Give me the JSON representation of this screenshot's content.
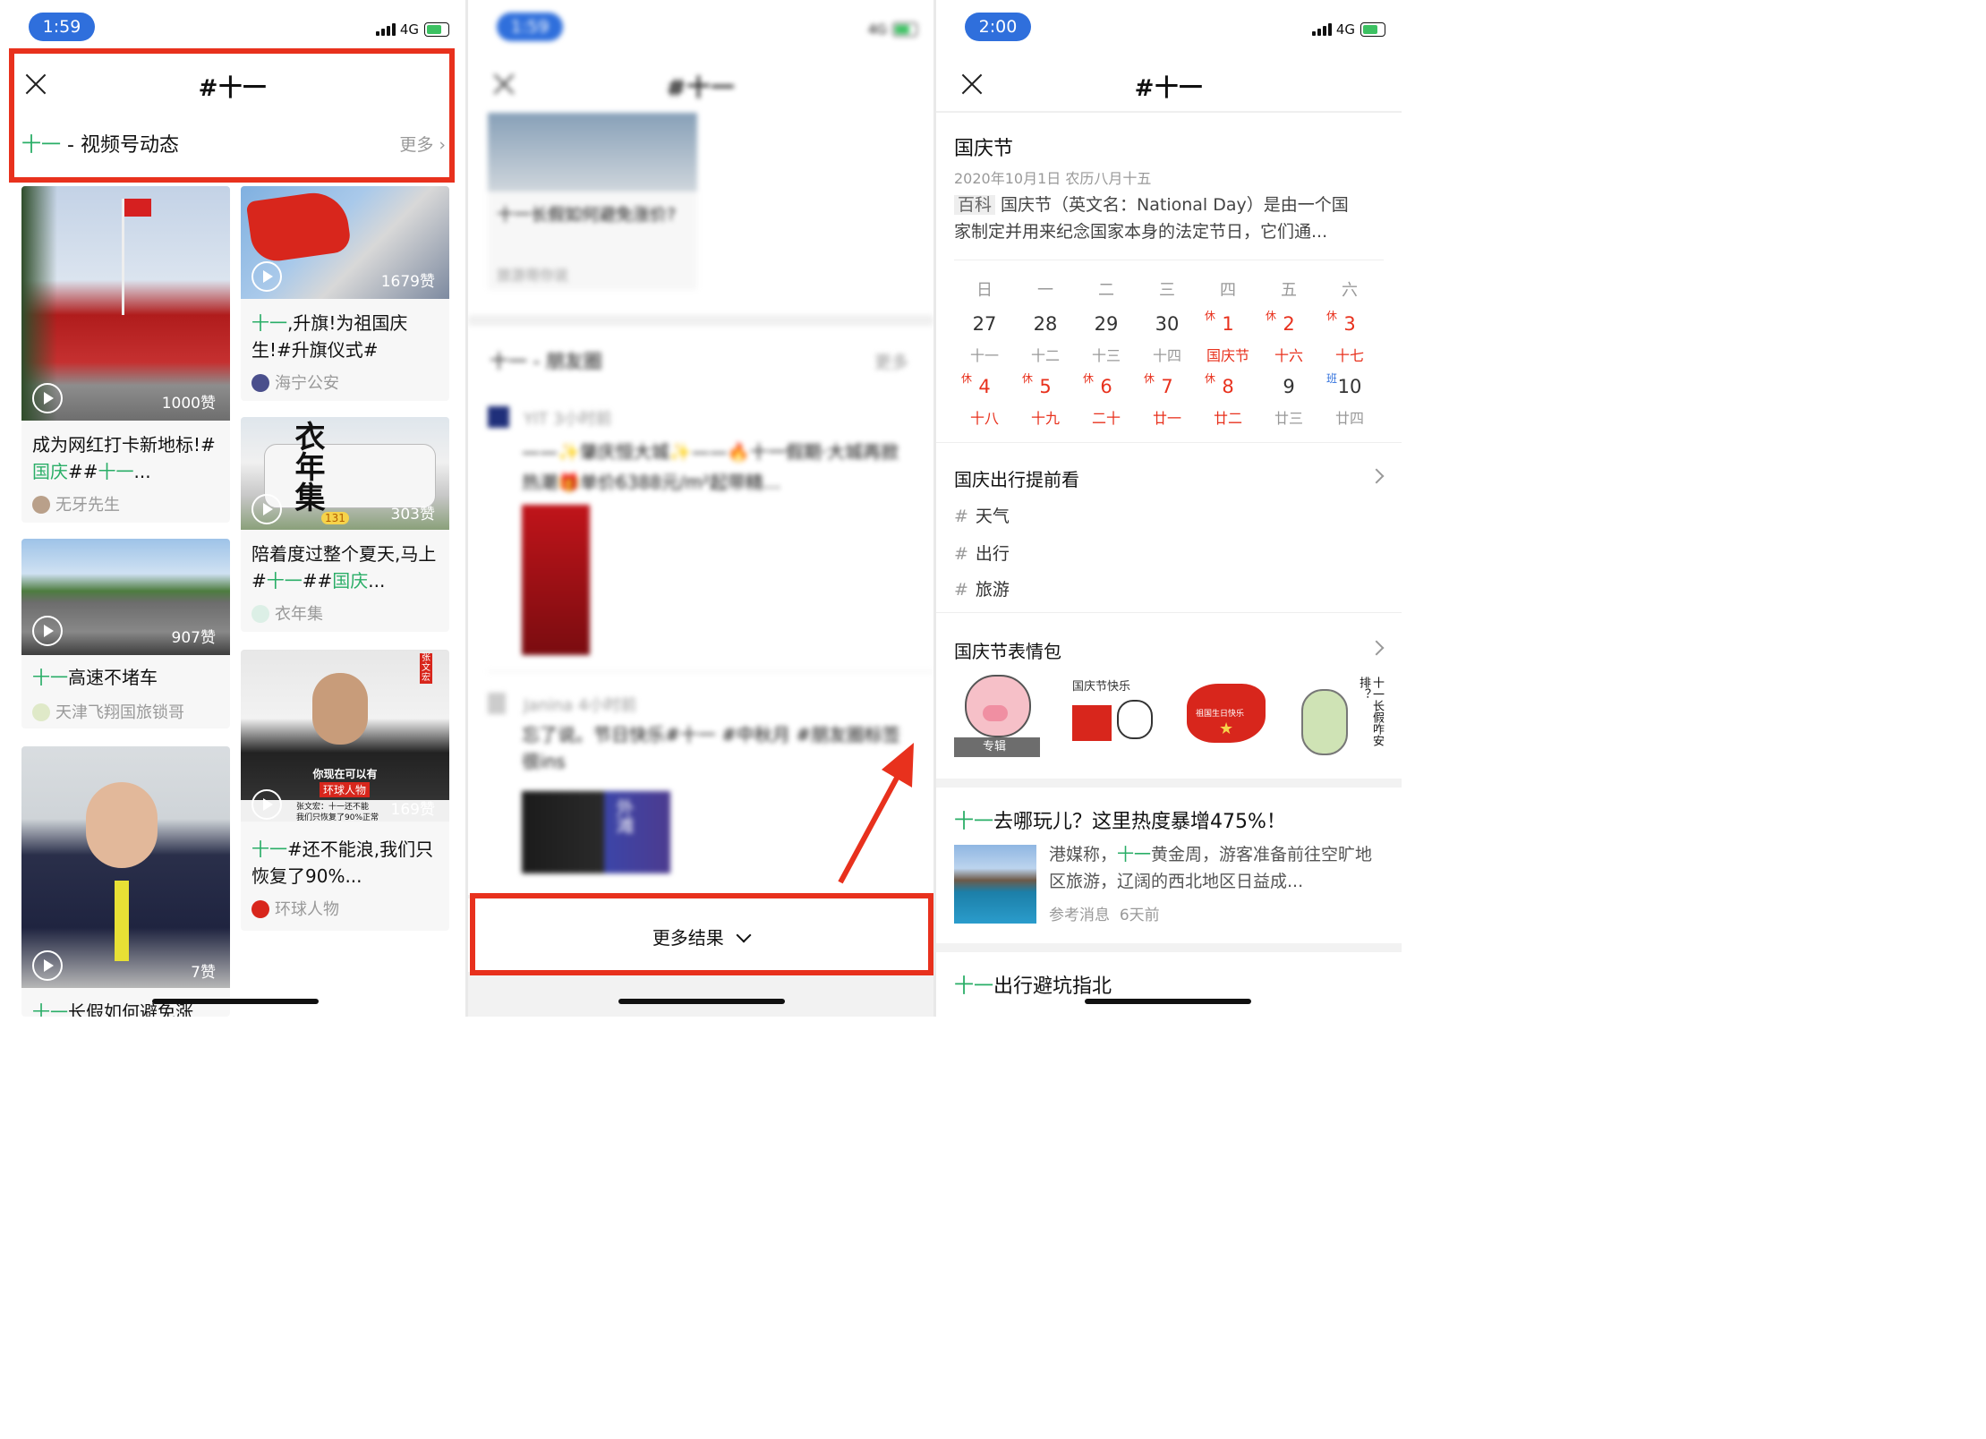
{
  "panel1": {
    "status": {
      "time": "1:59",
      "network": "4G"
    },
    "title": "#十一",
    "section": {
      "keyword": "十一",
      "label": " - 视频号动态",
      "more": "更多"
    },
    "cards": [
      {
        "likes": "1000赞",
        "title_a": "成为网红打卡新地标!#",
        "title_b_green": "国庆",
        "title_c": "##",
        "title_d_green": "十一",
        "title_e": "...",
        "author": "无牙先生"
      },
      {
        "likes": "907赞",
        "title_green": "十一",
        "title_rest": "高速不堵车",
        "author": "天津飞翔国旅锁哥"
      },
      {
        "likes": "7赞",
        "title_green": "十一",
        "title_rest": "长假如何避免涨"
      },
      {
        "likes": "1679赞",
        "title_green": "十一",
        "title_rest": ",升旗!为祖国庆生!#升旗仪式#",
        "author": "海宁公安"
      },
      {
        "likes": "303赞",
        "title_a": "陪着度过整个夏天,马上#",
        "title_b_green": "十一",
        "title_c": "##",
        "title_d_green": "国庆",
        "title_e": "...",
        "author": "衣年集",
        "poster_text": "衣年集",
        "poster_num": "131"
      },
      {
        "likes": "169赞",
        "title_green": "十一",
        "title_rest": "#还不能浪,我们只恢复了90%...",
        "author": "环球人物",
        "poster_line1": "你现在可以有",
        "poster_line2": "环球人物",
        "poster_line3": "张文宏：十一还不能",
        "poster_line4": "我们只恢复了90%正常",
        "poster_side": "张文宏"
      }
    ]
  },
  "panel2": {
    "status": {
      "time": "1:59",
      "network": "4G"
    },
    "title": "#十一",
    "snip_title": "十一长假如何避免涨价?",
    "snip_author": "旅游哥你说",
    "section_label": "十一 - 朋友圈",
    "section_more": "更多",
    "post1_author": "YIT 3小时前",
    "post1_text": "——✨肇庆恒大城✨——🔥十一假期·大城再掀热潮🎁单价6388元/m²起带精...",
    "post2_author": "Janina 4小时前",
    "post2_text": "忘了说。节日快乐#十一 #中秋月 #朋友圈标签很ins",
    "poster_text": "外滩",
    "more_results": "更多结果"
  },
  "panel3": {
    "status": {
      "time": "2:00",
      "network": "4G"
    },
    "title": "#十一",
    "holiday_title": "国庆节",
    "holiday_date": "2020年10月1日 农历八月十五",
    "baike_tag": "百科",
    "baike_text_1": "国庆节（英文名：National Day）是由一个国",
    "baike_text_2": "家制定并用来纪念国家本身的法定节日，它们通...",
    "calendar": {
      "headers": [
        "日",
        "一",
        "二",
        "三",
        "四",
        "五",
        "六"
      ],
      "row1": [
        {
          "d": "27",
          "l": "十一",
          "mark": "",
          "red": false
        },
        {
          "d": "28",
          "l": "十二",
          "mark": "",
          "red": false
        },
        {
          "d": "29",
          "l": "十三",
          "mark": "",
          "red": false
        },
        {
          "d": "30",
          "l": "十四",
          "mark": "",
          "red": false
        },
        {
          "d": "1",
          "l": "国庆节",
          "mark": "休",
          "red": true
        },
        {
          "d": "2",
          "l": "十六",
          "mark": "休",
          "red": true
        },
        {
          "d": "3",
          "l": "十七",
          "mark": "休",
          "red": true
        }
      ],
      "row2": [
        {
          "d": "4",
          "l": "十八",
          "mark": "休",
          "red": true
        },
        {
          "d": "5",
          "l": "十九",
          "mark": "休",
          "red": true
        },
        {
          "d": "6",
          "l": "二十",
          "mark": "休",
          "red": true
        },
        {
          "d": "7",
          "l": "廿一",
          "mark": "休",
          "red": true
        },
        {
          "d": "8",
          "l": "廿二",
          "mark": "休",
          "red": true
        },
        {
          "d": "9",
          "l": "廿三",
          "mark": "",
          "red": false
        },
        {
          "d": "10",
          "l": "廿四",
          "mark": "班",
          "red": false
        }
      ]
    },
    "travel_title": "国庆出行提前看",
    "tags": [
      "天气",
      "出行",
      "旅游"
    ],
    "emoji_title": "国庆节表情包",
    "emoji_album": "专辑",
    "emoji2_text": "国庆节快乐",
    "emoji3_text": "祖国生日快乐",
    "emoji4_text": "十一长假咋安排？",
    "article1": {
      "title_green": "十一",
      "title_rest": "去哪玩儿？这里热度暴增475%！",
      "snip_a": "港媒称，",
      "snip_green": "十一",
      "snip_b": "黄金周，游客准备前往空旷地区旅游，辽阔的西北地区日益成...",
      "source": "参考消息",
      "time": "6天前"
    },
    "article2": {
      "title_green": "十一",
      "title_rest": "出行避坑指北"
    }
  },
  "colors": {
    "accent_green": "#2aae67",
    "highlight_red": "#e8311d",
    "pill_blue": "#2f6fdc"
  }
}
